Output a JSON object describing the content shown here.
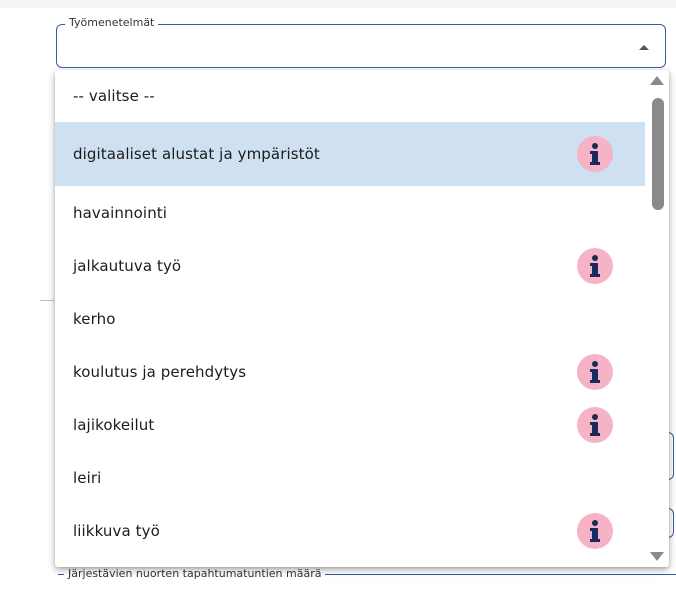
{
  "field": {
    "label": "Työmenetelmät",
    "value": ""
  },
  "dropdown": {
    "options": [
      {
        "label": "-- valitse --",
        "info": false,
        "selected": false
      },
      {
        "label": "digitaaliset alustat ja ympäristöt",
        "info": true,
        "selected": true
      },
      {
        "label": "havainnointi",
        "info": false,
        "selected": false
      },
      {
        "label": "jalkautuva työ",
        "info": true,
        "selected": false
      },
      {
        "label": "kerho",
        "info": false,
        "selected": false
      },
      {
        "label": "koulutus ja perehdytys",
        "info": true,
        "selected": false
      },
      {
        "label": "lajikokeilut",
        "info": true,
        "selected": false
      },
      {
        "label": "leiri",
        "info": false,
        "selected": false
      },
      {
        "label": "liikkuva työ",
        "info": true,
        "selected": false
      }
    ]
  },
  "background": {
    "next_field_label": "Järjestävien nuorten tapahtumatuntien määrä"
  },
  "colors": {
    "field_border": "#3b5ba9",
    "selected_option": "#cfe0f2",
    "info_icon_bg": "#f6b3c6",
    "info_icon_fg": "#1a2a5a",
    "scrollbar": "#8a8a8a"
  },
  "icons": {
    "info": "info-icon",
    "dropdown_arrow": "caret-up-icon",
    "scroll_up": "scroll-up-arrow-icon",
    "scroll_down": "scroll-down-arrow-icon"
  }
}
